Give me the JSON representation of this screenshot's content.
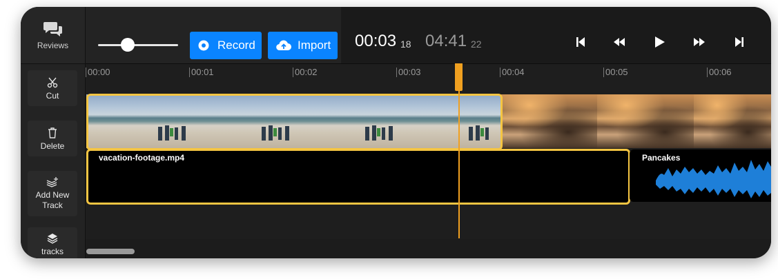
{
  "sidebar": {
    "reviews_label": "Reviews",
    "cut_label": "Cut",
    "delete_label": "Delete",
    "add_track_label_line1": "Add New",
    "add_track_label_line2": "Track",
    "tracks_label": "tracks"
  },
  "toolbar": {
    "record_label": "Record",
    "import_label": "Import",
    "zoom_level": 0.37
  },
  "timecode": {
    "current": "00:03",
    "current_frames": "18",
    "total": "04:41",
    "total_frames": "22"
  },
  "transport": {
    "icons": [
      "skip-back-icon",
      "rewind-icon",
      "play-icon",
      "fast-forward-icon",
      "skip-forward-icon"
    ]
  },
  "ruler": {
    "ticks": [
      "00:00",
      "00:01",
      "00:02",
      "00:03",
      "00:04",
      "00:05",
      "00:06"
    ]
  },
  "clips": {
    "video_track": [
      "beach",
      "sunset-water"
    ],
    "audio_selected_name": "vacation-footage.mp4",
    "audio_second_name": "Pancakes"
  },
  "colors": {
    "accent_blue": "#0a84ff",
    "selection_yellow": "#f5c542",
    "playhead_orange": "#f0a020",
    "waveform_blue": "#1e7fd8"
  }
}
